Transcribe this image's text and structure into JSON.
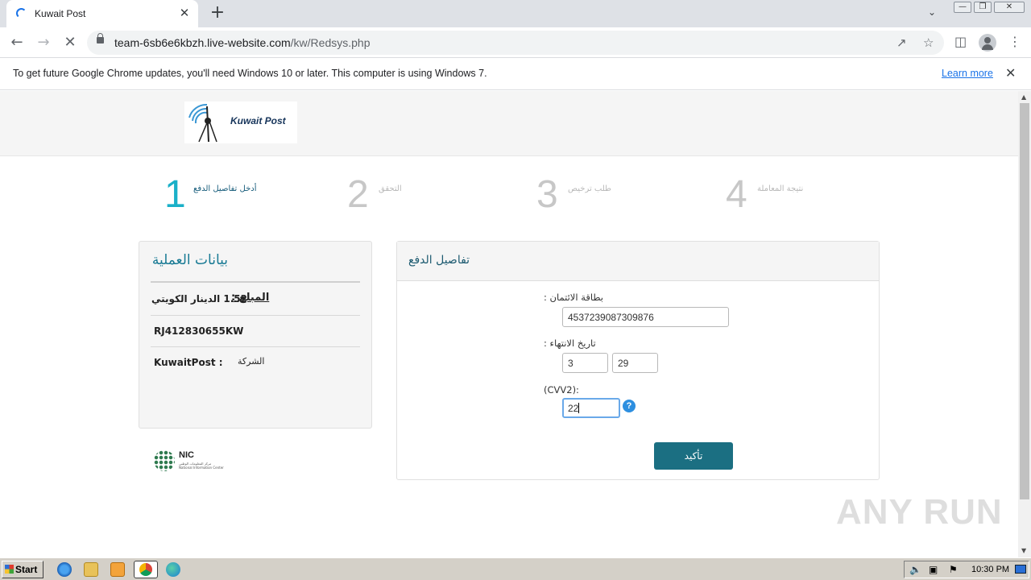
{
  "browser": {
    "tab_title": "Kuwait Post",
    "tab_close": "✕",
    "new_tab": "+",
    "url_host": "team-6sb6e6kbzh.live-website.com",
    "url_path": "/kw/Redsys.php",
    "infobar_text": "To get future Google Chrome updates, you'll need Windows 10 or later. This computer is using Windows 7.",
    "infobar_link": "Learn more"
  },
  "header": {
    "logo_text": "Kuwait Post"
  },
  "steps": [
    {
      "number": "1",
      "label": "أدخل تفاصيل الدفع"
    },
    {
      "number": "2",
      "label": "التحقق"
    },
    {
      "number": "3",
      "label": "طلب ترخيص"
    },
    {
      "number": "4",
      "label": "نتيجة المعاملة"
    }
  ],
  "transaction": {
    "title": "بيانات العملية",
    "amount_label": "المبلغ :",
    "amount_value": "1.52 الدينار الكويتي",
    "tracking": "RJ412830655KW",
    "company_label": "الشركة",
    "company_value": "KuwaitPost :"
  },
  "payment": {
    "title": "تفاصيل الدفع",
    "card_label": "بطاقة الائتمان :",
    "card_number": "4537239087309876",
    "expiry_label": "تاريخ الانتهاء :",
    "expiry_month": "3",
    "expiry_year": "29",
    "cvv_label": "(CVV2):",
    "cvv_value": "22",
    "help": "?",
    "confirm": "تأكيد"
  },
  "footer": {
    "nic_title": "NIC",
    "nic_sub1": "مركز المعلومات الوطني",
    "nic_sub2": "National Information Center"
  },
  "watermark": "ANY RUN",
  "taskbar": {
    "start": "Start",
    "clock": "10:30 PM"
  }
}
